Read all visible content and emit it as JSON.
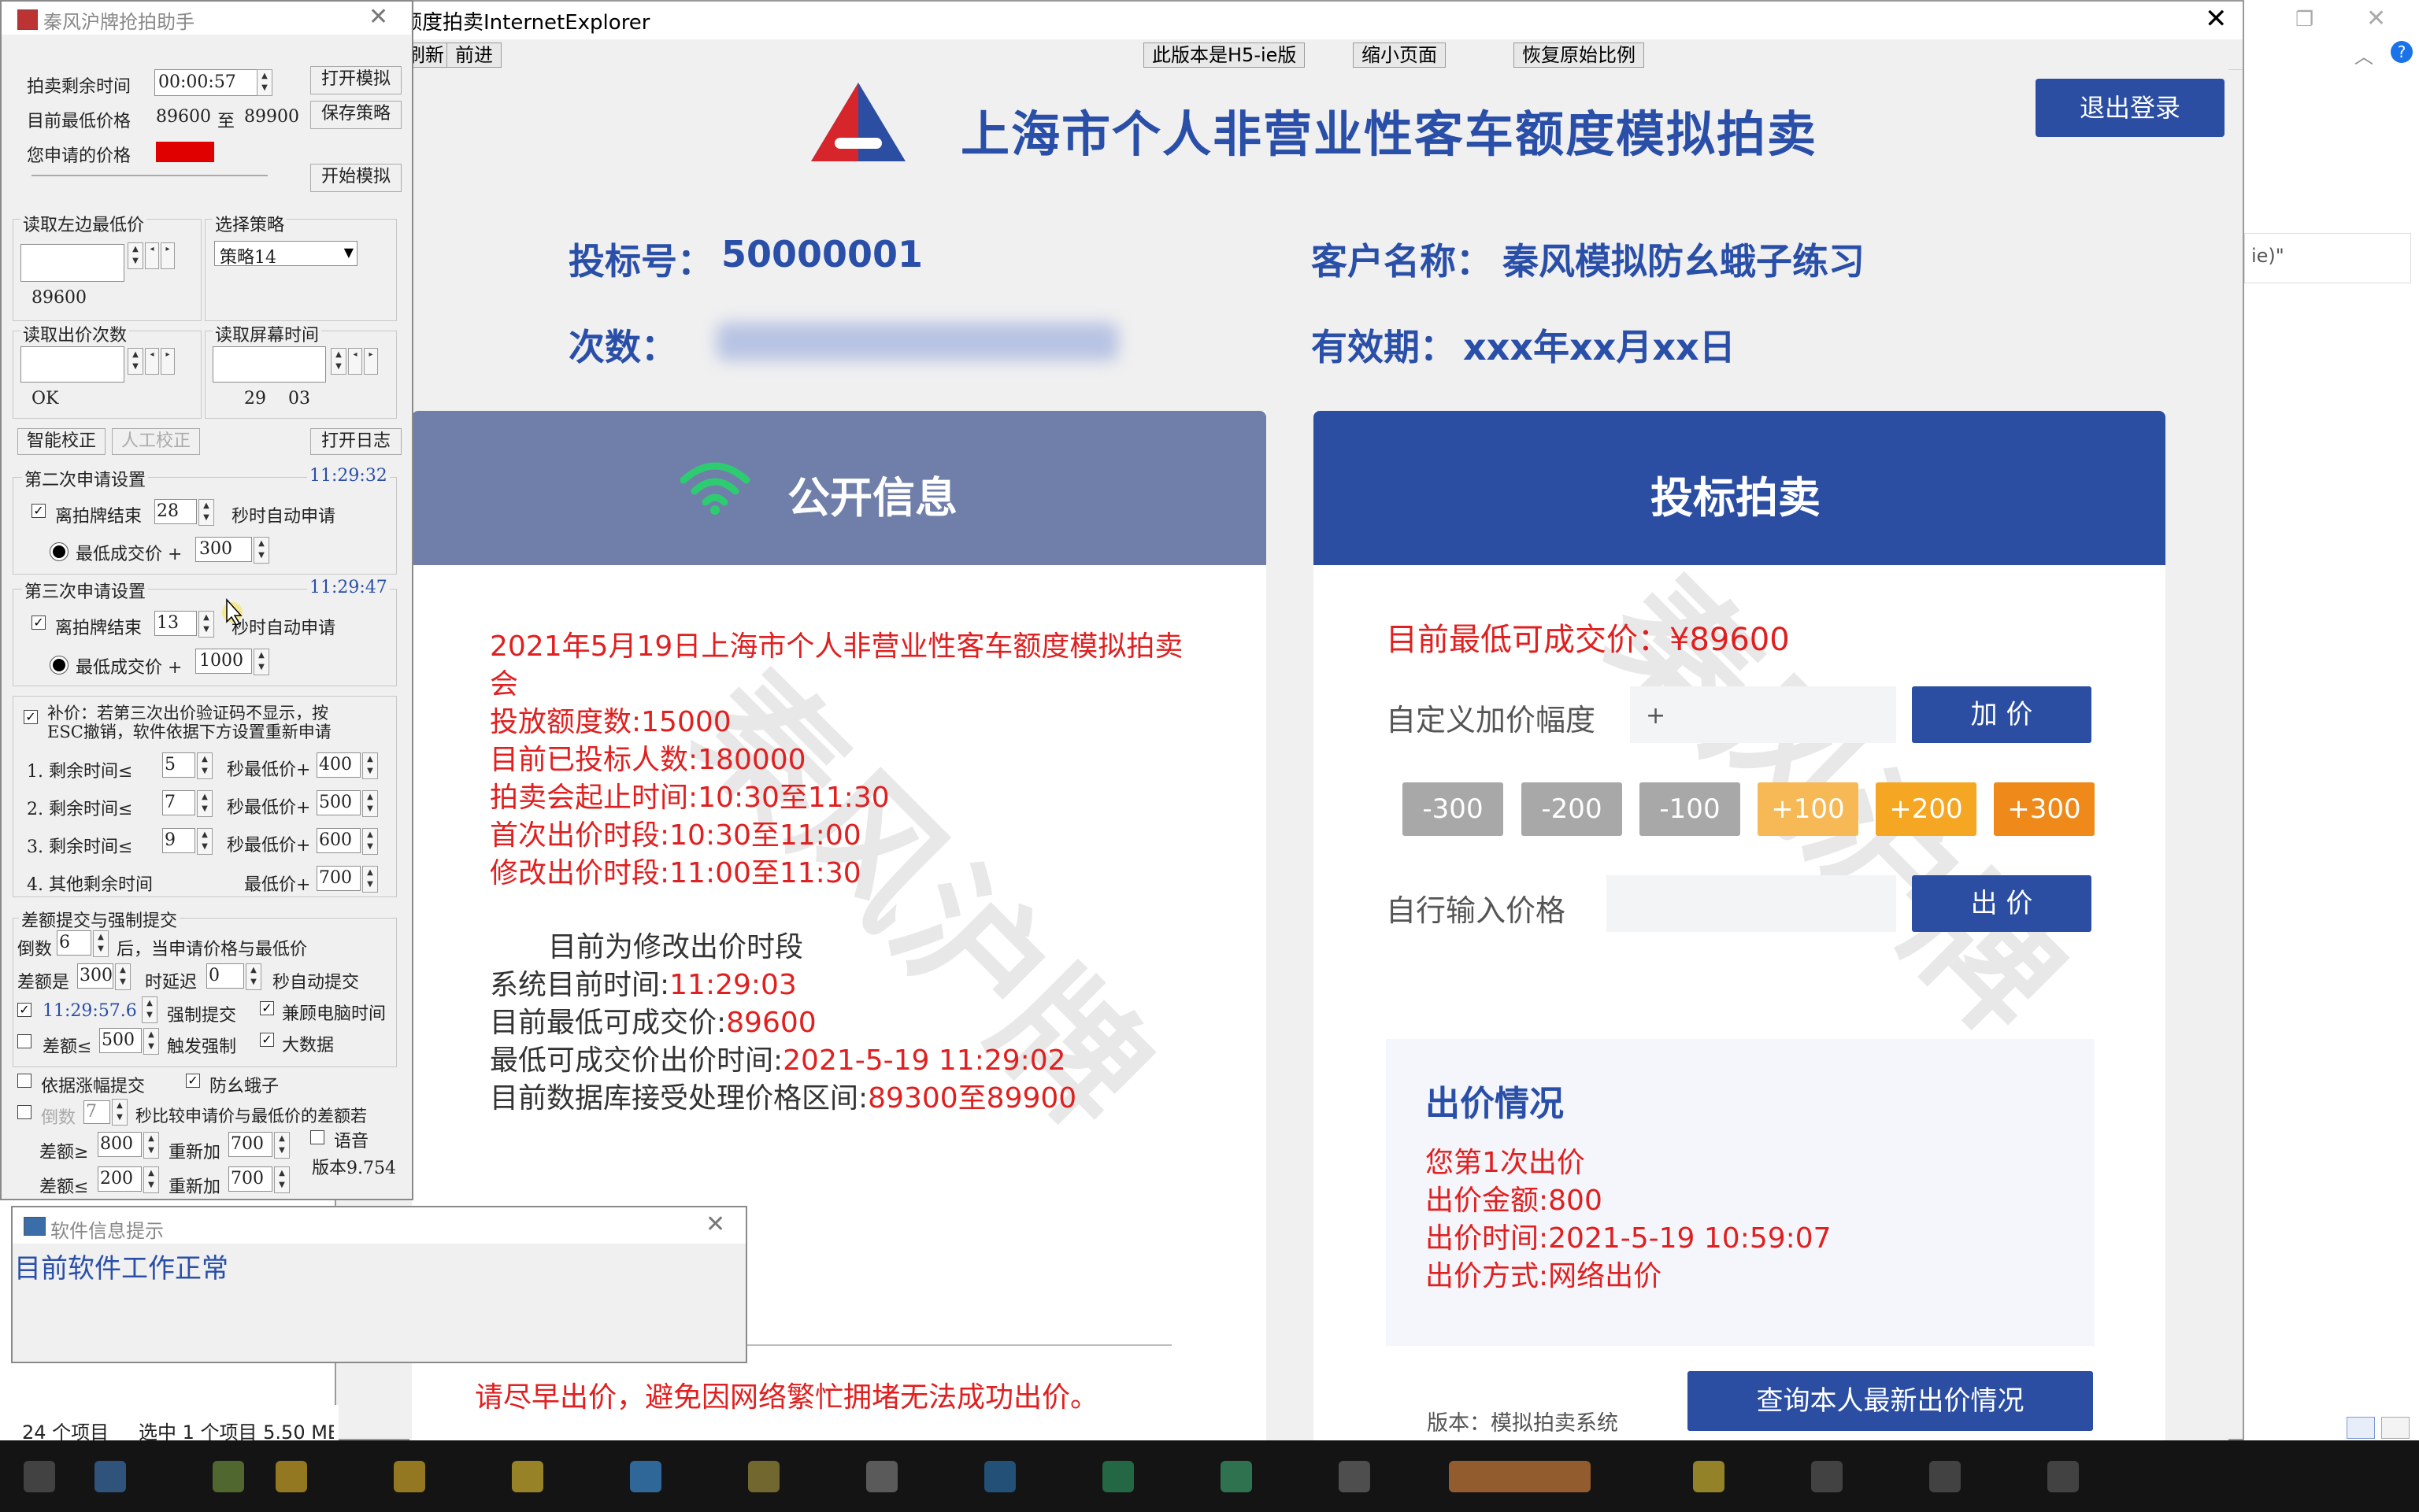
{
  "desktop": {
    "status_items": "24 个项目",
    "status_selected": "选中 1 个项目  5.50 MB",
    "right_fragment": "ie)\""
  },
  "ie": {
    "title": "额度拍卖InternetExplorer",
    "toolbar": {
      "refresh": "刷新",
      "forward": "前进",
      "h5": "此版本是H5-ie版",
      "shrink": "缩小页面",
      "restore": "恢复原始比例"
    }
  },
  "page": {
    "title": "上海市个人非营业性客车额度模拟拍卖",
    "logout": "退出登录",
    "bid_no_label": "投标号：",
    "bid_no": "50000001",
    "customer_label": "客户名称：",
    "customer": "秦风模拟防幺蛾子练习",
    "count_label": "次数：",
    "validity_label": "有效期：",
    "validity": "xxx年xx月xx日",
    "watermark": "秦风沪牌"
  },
  "public_info": {
    "heading": "公开信息",
    "line1": "2021年5月19日上海市个人非营业性客车额度模拟拍卖",
    "line1b": "会",
    "quota": "投放额度数:15000",
    "bidders": "目前已投标人数:180000",
    "auction_time": "拍卖会起止时间:10:30至11:30",
    "first_period": "首次出价时段:10:30至11:00",
    "modify_period": "修改出价时段:11:00至11:30",
    "phase": "目前为修改出价时段",
    "sys_time_label": "系统目前时间:",
    "sys_time": "11:29:03",
    "lowest_label": "目前最低可成交价:",
    "lowest": "89600",
    "lowest_time_label": "最低可成交价出价时间:",
    "lowest_time": "2021-5-19 11:29:02",
    "range_label": "目前数据库接受处理价格区间:",
    "range": "89300至89900",
    "warning": "请尽早出价，避免因网络繁忙拥堵无法成功出价。"
  },
  "bidding": {
    "heading": "投标拍卖",
    "current_lowest": "目前最低可成交价：¥89600",
    "custom_label": "自定义加价幅度",
    "custom_value": "+",
    "add_btn": "加 价",
    "steps": [
      "-300",
      "-200",
      "-100",
      "+100",
      "+200",
      "+300"
    ],
    "input_label": "自行输入价格",
    "bid_btn": "出 价",
    "status_heading": "出价情况",
    "status_lines": [
      "您第1次出价",
      "出价金额:800",
      "出价时间:2021-5-19 10:59:07",
      "出价方式:网络出价"
    ],
    "version": "版本：模拟拍卖系统",
    "query_btn": "查询本人最新出价情况"
  },
  "helper": {
    "title": "秦风沪牌抢拍助手",
    "remain_label": "拍卖剩余时间",
    "remain_value": "00:00:57",
    "open_sim": "打开模拟",
    "lowest_label": "目前最低价格",
    "lowest_from": "89600",
    "lowest_to_sep": "至",
    "lowest_to": "89900",
    "save_strategy": "保存策略",
    "your_price_label": "您申请的价格",
    "start_sim": "开始模拟",
    "read_left_label": "读取左边最低价",
    "read_left_value": "89600",
    "strategy_label": "选择策略",
    "strategy_value": "策略14",
    "read_count_label": "读取出价次数",
    "read_count_value": "OK",
    "read_screen_label": "读取屏幕时间",
    "read_screen_value": "29    03",
    "smart_correct": "智能校正",
    "manual_correct": "人工校正",
    "open_log": "打开日志",
    "second_label": "第二次申请设置",
    "second_time": "11:29:32",
    "second_secs": "28",
    "second_add": "300",
    "third_label": "第三次申请设置",
    "third_time": "11:29:47",
    "third_secs": "13",
    "third_add": "1000",
    "before_end": "离拍牌结束",
    "auto_apply": "秒时自动申请",
    "lowest_plus": "最低成交价  +",
    "supp_text1": "补价：若第三次出价验证码不显示，按",
    "supp_text2": "ESC撤销，软件依据下方设置重新申请",
    "supp_rows": [
      {
        "idx": "1.  剩余时间≤",
        "secs": "5",
        "mid": "秒最低价+",
        "add": "400"
      },
      {
        "idx": "2.  剩余时间≤",
        "secs": "7",
        "mid": "秒最低价+",
        "add": "500"
      },
      {
        "idx": "3.  剩余时间≤",
        "secs": "9",
        "mid": "秒最低价+",
        "add": "600"
      }
    ],
    "other_label": "4.  其他剩余时间",
    "other_mid": "最低价+",
    "other_add": "700",
    "force_label": "差额提交与强制提交",
    "countdown_label": "倒数",
    "countdown_value": "6",
    "countdown_tail": "后，当申请价格与最低价",
    "diff_label": "差额是",
    "diff_value": "300",
    "delay_label": "时延迟",
    "delay_value": "0",
    "auto_submit": "秒自动提交",
    "force_time": "11:29:57.6",
    "force_submit": "强制提交",
    "compat_time": "兼顾电脑时间",
    "diff_le": "差额≤",
    "diff_le_value": "500",
    "trigger_force": "触发强制",
    "big_data": "大数据",
    "by_increase": "依据涨幅提交",
    "anti_trick": "防幺蛾子",
    "countdown2_label": "倒数",
    "countdown2_value": "7",
    "countdown2_tail": "秒比较申请价与最低价的差额若",
    "ge_label": "差额≥",
    "ge_value": "800",
    "readd_label": "重新加",
    "ge_add": "700",
    "voice": "语音",
    "le_label": "差额≤",
    "le_value": "200",
    "le_add": "700",
    "version": "版本9.754"
  },
  "popup": {
    "title": "软件信息提示",
    "message": "目前软件工作正常"
  },
  "colors": {
    "accent_blue": "#2b4ea3",
    "panel_gray_blue": "#6f7fa9",
    "alert_red": "#e02020",
    "orange": "#f5a623",
    "gray_btn": "#a8a8a8"
  }
}
